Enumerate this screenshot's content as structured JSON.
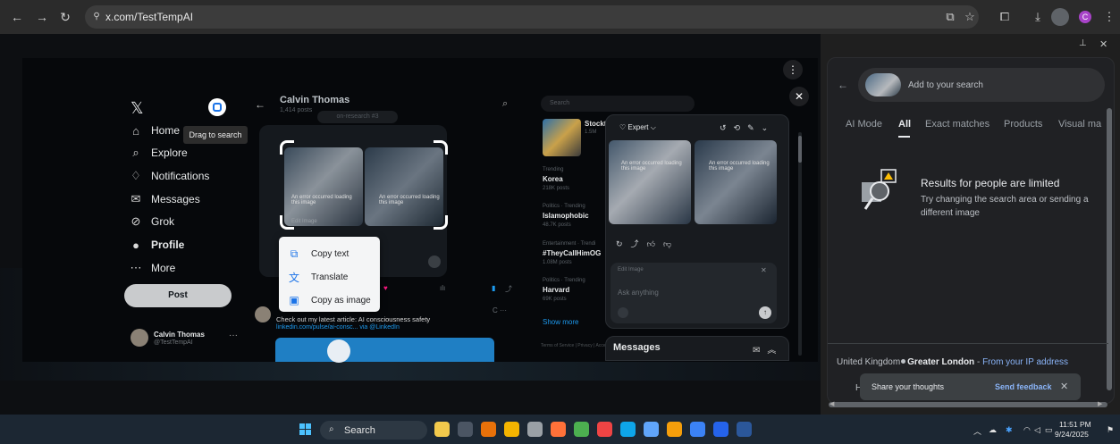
{
  "browser": {
    "url": "x.com/TestTempAI",
    "profile_initial": "C",
    "nav_icons": [
      "back-icon",
      "forward-icon",
      "reload-icon",
      "site-info-icon"
    ],
    "toolbar_icons": [
      "cast-icon",
      "bookmark-star-icon",
      "extensions-icon",
      "downloads-icon",
      "lens-icon",
      "menu-icon"
    ]
  },
  "x": {
    "logo": "𝕏",
    "tooltip": "Drag to search",
    "nav": [
      {
        "label": "Home",
        "icon": "⌂"
      },
      {
        "label": "Explore",
        "icon": "⌕"
      },
      {
        "label": "Notifications",
        "icon": "♢"
      },
      {
        "label": "Messages",
        "icon": "✉"
      },
      {
        "label": "Grok",
        "icon": "⊘"
      },
      {
        "label": "Profile",
        "icon": "●"
      },
      {
        "label": "More",
        "icon": "⋯"
      }
    ],
    "post_button": "Post",
    "user": {
      "name": "Calvin Thomas",
      "handle": "@TestTempAI"
    },
    "profile_header": {
      "name": "Calvin Thomas",
      "count": "1,414 posts"
    },
    "pill_faint": "on-research #3",
    "image_caption_1": "An error occurred loading this image",
    "image_caption_2": "An error occurred loading this image",
    "image_edit_label": "Edit Image",
    "tweet2": {
      "text": "Check out my latest article: AI consciousness safety",
      "link": "linkedin.com/pulse/ai-consc... via @LinkedIn"
    },
    "context_menu": [
      {
        "label": "Copy text",
        "icon": "⧉"
      },
      {
        "label": "Translate",
        "icon": "文"
      },
      {
        "label": "Copy as image",
        "icon": "▣"
      }
    ],
    "trends_search_placeholder": "Search",
    "stock_title": "Stockt",
    "stock_sub": "1.5M",
    "trends": [
      {
        "category": "Trending",
        "name": "Korea",
        "count": "218K posts"
      },
      {
        "category": "Politics · Trending",
        "name": "Islamophobic",
        "count": "48.7K posts"
      },
      {
        "category": "Entertainment · Trendi",
        "name": "#TheyCallHimOG",
        "count": "1.08M posts"
      },
      {
        "category": "Politics · Trending",
        "name": "Harvard",
        "count": "69K posts"
      }
    ],
    "show_more": "Show more",
    "tos": "Terms of Service | Privacy | Accessibility | Ads info",
    "grok": {
      "mode": "Expert ⌵",
      "edit_label": "Edit Image",
      "ask_placeholder": "Ask anything",
      "caption_1": "An error occurred loading this image",
      "caption_2": "An error occurred loading this image"
    },
    "messages_label": "Messages"
  },
  "lens": {
    "search_placeholder": "Add to your search",
    "tabs": [
      "AI Mode",
      "All",
      "Exact matches",
      "Products",
      "Visual ma"
    ],
    "active_tab": "All",
    "result_title": "Results for people are limited",
    "result_text": "Try changing the search area or sending a different image",
    "location_country": "United Kingdom",
    "location_region": "Greater London",
    "location_sep": " - ",
    "location_source": "From your IP address",
    "feedback_prefix": "H",
    "feedback_text": "Share your thoughts",
    "feedback_send": "Send feedback"
  },
  "taskbar": {
    "search_label": "Search",
    "time": "11:51 PM",
    "date": "9/24/2025",
    "apps": [
      "#f2c94c",
      "#4b5563",
      "#e8710a",
      "#f4b400",
      "#9aa0a6",
      "#ff7139",
      "#4caf50",
      "#ef4444",
      "#0ea5e9",
      "#60a5fa",
      "#f59e0b",
      "#3b82f6",
      "#2563eb",
      "#2b579a"
    ]
  }
}
